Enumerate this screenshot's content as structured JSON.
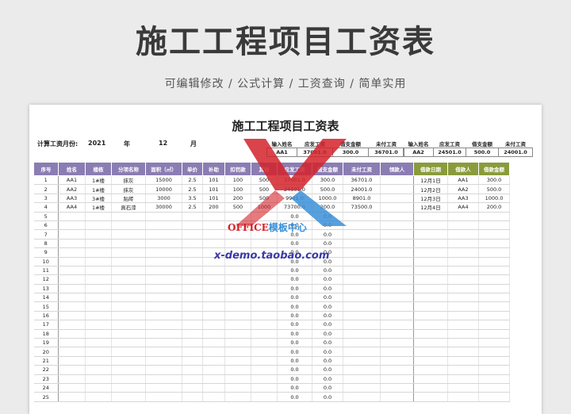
{
  "page": {
    "title": "施工工程项目工资表",
    "subtitle": "可编辑修改 / 公式计算 / 工资查询 / 简单实用"
  },
  "sheet": {
    "title": "施工工程项目工资表",
    "month_label": "计算工资月份:",
    "year": "2021",
    "year_unit": "年",
    "month": "12",
    "month_unit": "月",
    "query": {
      "headers": [
        "输入姓名",
        "应发工资",
        "借支金额",
        "未付工资"
      ],
      "values": [
        "AA1",
        "37001.0",
        "300.0",
        "36701.0"
      ]
    },
    "query2": {
      "headers": [
        "输入姓名",
        "应发工资",
        "借支金额",
        "未付工资"
      ],
      "values": [
        "AA2",
        "24501.0",
        "500.0",
        "24001.0"
      ]
    },
    "columns": [
      "序号",
      "姓名",
      "楼栋",
      "分项名称",
      "面积（㎡）",
      "单价",
      "补助",
      "扣罚款",
      "其他",
      "应发工资",
      "借支金额",
      "未付工资",
      "领款人",
      "借款日期",
      "借款人",
      "借款金额"
    ],
    "rows": [
      [
        "1",
        "AA1",
        "1#楼",
        "抹灰",
        "15000",
        "2.5",
        "101",
        "100",
        "500",
        "37001.0",
        "300.0",
        "36701.0",
        "",
        "12月1日",
        "AA1",
        "300.0"
      ],
      [
        "2",
        "AA2",
        "1#楼",
        "抹灰",
        "10000",
        "2.5",
        "101",
        "100",
        "500",
        "24501.0",
        "500.0",
        "24001.0",
        "",
        "12月2日",
        "AA2",
        "500.0"
      ],
      [
        "3",
        "AA3",
        "3#楼",
        "贴砖",
        "3000",
        "3.5",
        "101",
        "200",
        "500",
        "9901.0",
        "1000.0",
        "8901.0",
        "",
        "12月3日",
        "AA3",
        "1000.0"
      ],
      [
        "4",
        "AA4",
        "1#楼",
        "真石漆",
        "30000",
        "2.5",
        "200",
        "500",
        "1000",
        "73700.0",
        "200.0",
        "73500.0",
        "",
        "12月4日",
        "AA4",
        "200.0"
      ],
      [
        "5",
        "",
        "",
        "",
        "",
        "",
        "",
        "",
        "",
        "0.0",
        "0.0",
        "",
        "",
        "",
        "",
        ""
      ],
      [
        "6",
        "",
        "",
        "",
        "",
        "",
        "",
        "",
        "",
        "0.0",
        "0.0",
        "",
        "",
        "",
        "",
        ""
      ],
      [
        "7",
        "",
        "",
        "",
        "",
        "",
        "",
        "",
        "",
        "0.0",
        "0.0",
        "",
        "",
        "",
        "",
        ""
      ],
      [
        "8",
        "",
        "",
        "",
        "",
        "",
        "",
        "",
        "",
        "0.0",
        "0.0",
        "",
        "",
        "",
        "",
        ""
      ],
      [
        "9",
        "",
        "",
        "",
        "",
        "",
        "",
        "",
        "",
        "0.0",
        "0.0",
        "",
        "",
        "",
        "",
        ""
      ],
      [
        "10",
        "",
        "",
        "",
        "",
        "",
        "",
        "",
        "",
        "0.0",
        "0.0",
        "",
        "",
        "",
        "",
        ""
      ],
      [
        "11",
        "",
        "",
        "",
        "",
        "",
        "",
        "",
        "",
        "0.0",
        "0.0",
        "",
        "",
        "",
        "",
        ""
      ],
      [
        "12",
        "",
        "",
        "",
        "",
        "",
        "",
        "",
        "",
        "0.0",
        "0.0",
        "",
        "",
        "",
        "",
        ""
      ],
      [
        "13",
        "",
        "",
        "",
        "",
        "",
        "",
        "",
        "",
        "0.0",
        "0.0",
        "",
        "",
        "",
        "",
        ""
      ],
      [
        "14",
        "",
        "",
        "",
        "",
        "",
        "",
        "",
        "",
        "0.0",
        "0.0",
        "",
        "",
        "",
        "",
        ""
      ],
      [
        "15",
        "",
        "",
        "",
        "",
        "",
        "",
        "",
        "",
        "0.0",
        "0.0",
        "",
        "",
        "",
        "",
        ""
      ],
      [
        "16",
        "",
        "",
        "",
        "",
        "",
        "",
        "",
        "",
        "0.0",
        "0.0",
        "",
        "",
        "",
        "",
        ""
      ],
      [
        "17",
        "",
        "",
        "",
        "",
        "",
        "",
        "",
        "",
        "0.0",
        "0.0",
        "",
        "",
        "",
        "",
        ""
      ],
      [
        "18",
        "",
        "",
        "",
        "",
        "",
        "",
        "",
        "",
        "0.0",
        "0.0",
        "",
        "",
        "",
        "",
        ""
      ],
      [
        "19",
        "",
        "",
        "",
        "",
        "",
        "",
        "",
        "",
        "0.0",
        "0.0",
        "",
        "",
        "",
        "",
        ""
      ],
      [
        "20",
        "",
        "",
        "",
        "",
        "",
        "",
        "",
        "",
        "0.0",
        "0.0",
        "",
        "",
        "",
        "",
        ""
      ],
      [
        "21",
        "",
        "",
        "",
        "",
        "",
        "",
        "",
        "",
        "0.0",
        "0.0",
        "",
        "",
        "",
        "",
        ""
      ],
      [
        "22",
        "",
        "",
        "",
        "",
        "",
        "",
        "",
        "",
        "0.0",
        "0.0",
        "",
        "",
        "",
        "",
        ""
      ],
      [
        "23",
        "",
        "",
        "",
        "",
        "",
        "",
        "",
        "",
        "0.0",
        "0.0",
        "",
        "",
        "",
        "",
        ""
      ],
      [
        "24",
        "",
        "",
        "",
        "",
        "",
        "",
        "",
        "",
        "0.0",
        "0.0",
        "",
        "",
        "",
        "",
        ""
      ],
      [
        "25",
        "",
        "",
        "",
        "",
        "",
        "",
        "",
        "",
        "0.0",
        "0.0",
        "",
        "",
        "",
        "",
        ""
      ]
    ]
  },
  "watermark": {
    "brand_red": "OFFICE",
    "brand_blue": "模板中心",
    "url": "x-demo.taobao.com"
  },
  "colors": {
    "purple_header": "#8b7db3",
    "olive_header": "#8a9b3c",
    "watermark_red": "#d4222a",
    "watermark_blue": "#3a8fd8"
  }
}
